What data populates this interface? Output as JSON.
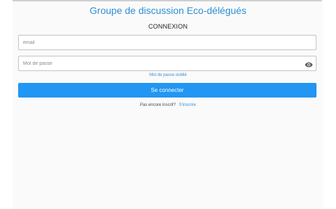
{
  "header": {
    "title": "Groupe de discussion Eco-délégués",
    "subtitle": "CONNEXION"
  },
  "form": {
    "email": {
      "value": "",
      "placeholder": "email"
    },
    "password": {
      "value": "",
      "placeholder": "Mot de passe",
      "toggle_icon": "eye-icon"
    },
    "forgot_label": "Mot de passe oublié",
    "submit_label": "Se connecter",
    "signup_prompt": "Pas encore inscrit?",
    "signup_link": "S'inscrire"
  },
  "colors": {
    "accent": "#2196f3",
    "link": "#2f8fd6"
  }
}
